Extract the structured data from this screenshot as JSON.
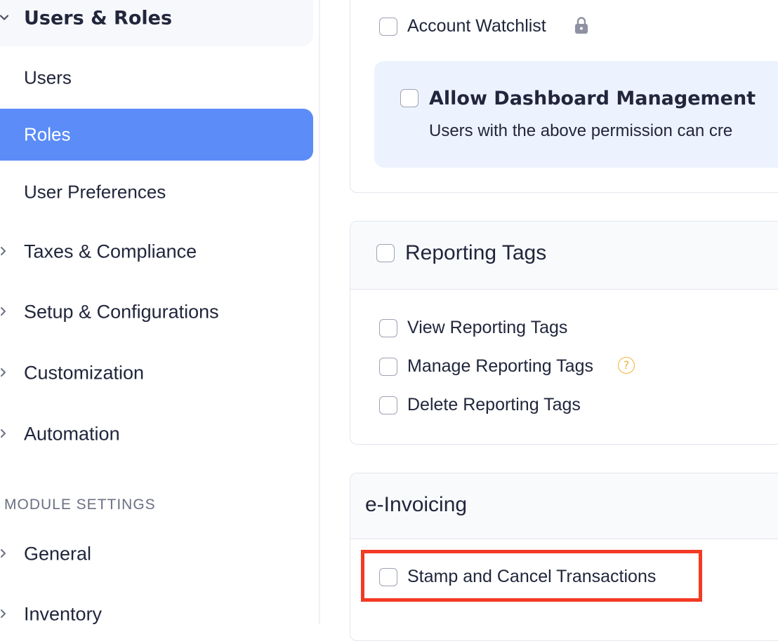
{
  "sidebar": {
    "group_open": {
      "label": "Users & Roles",
      "icon": "chevron-down-icon"
    },
    "sub_items": [
      {
        "label": "Users",
        "active": false
      },
      {
        "label": "Roles",
        "active": true
      },
      {
        "label": "User Preferences",
        "active": false
      }
    ],
    "groups": [
      {
        "label": "Taxes & Compliance",
        "icon": "chevron-right-icon"
      },
      {
        "label": "Setup & Configurations",
        "icon": "chevron-right-icon"
      },
      {
        "label": "Customization",
        "icon": "chevron-right-icon"
      },
      {
        "label": "Automation",
        "icon": "chevron-right-icon"
      }
    ],
    "module_settings_heading": "MODULE SETTINGS",
    "module_items": [
      {
        "label": "General",
        "icon": "chevron-right-icon"
      },
      {
        "label": "Inventory",
        "icon": "chevron-right-icon"
      }
    ]
  },
  "main": {
    "section_top": {
      "watchlist_label": "Account Watchlist",
      "watchlist_icon": "lock-icon",
      "dashboard_title": "Allow Dashboard Management",
      "dashboard_desc": "Users with the above permission can cre"
    },
    "reporting_tags": {
      "title": "Reporting Tags",
      "items": [
        {
          "label": "View Reporting Tags",
          "help": false
        },
        {
          "label": "Manage Reporting Tags",
          "help": true
        },
        {
          "label": "Delete Reporting Tags",
          "help": false
        }
      ],
      "help_glyph": "?"
    },
    "e_invoicing": {
      "title": "e-Invoicing",
      "items": [
        {
          "label": "Stamp and Cancel Transactions"
        }
      ]
    }
  },
  "colors": {
    "active_nav": "#5b8cf7",
    "highlight_border": "#f23a24",
    "info_box": "#edf3fe",
    "help_icon": "#f2b230"
  }
}
